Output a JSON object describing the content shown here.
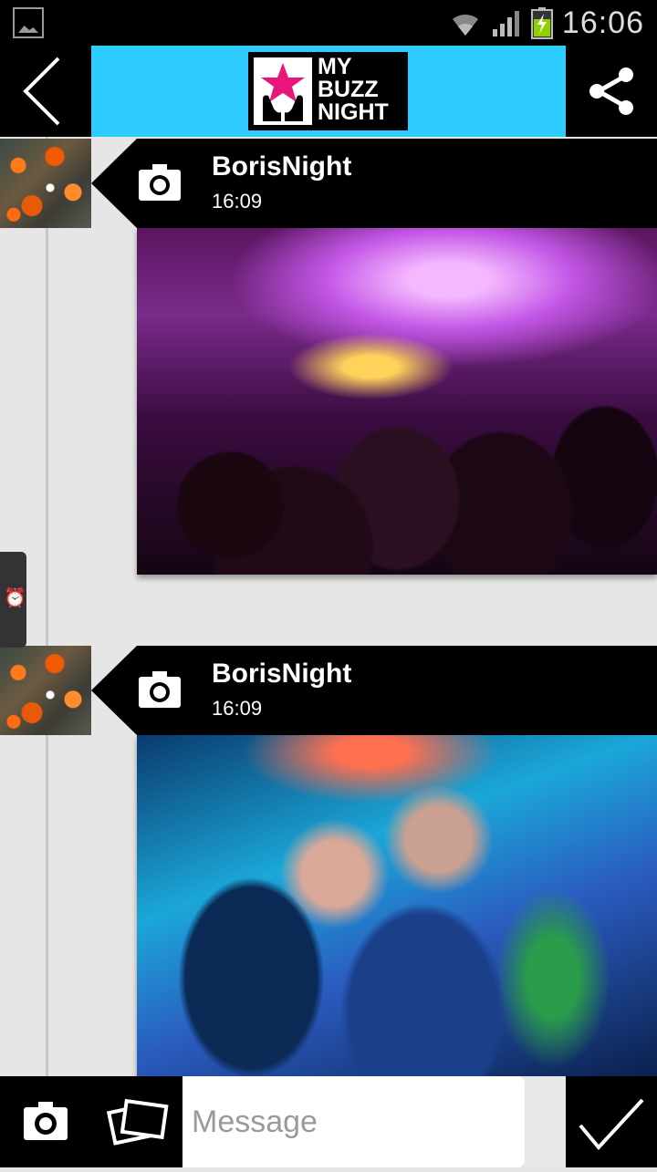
{
  "status_bar": {
    "time": "16:06"
  },
  "header": {
    "logo_lines": [
      "MY",
      "BUZZ",
      "NIGHT"
    ]
  },
  "posts": [
    {
      "author": "BorisNight",
      "time": "16:09",
      "photo": "concert-crowd-photo"
    },
    {
      "author": "BorisNight",
      "time": "16:09",
      "photo": "dancing-crowd-photo"
    }
  ],
  "composer": {
    "placeholder": "Message"
  },
  "colors": {
    "header_accent": "#2ecbff",
    "logo_star": "#e8157a"
  }
}
